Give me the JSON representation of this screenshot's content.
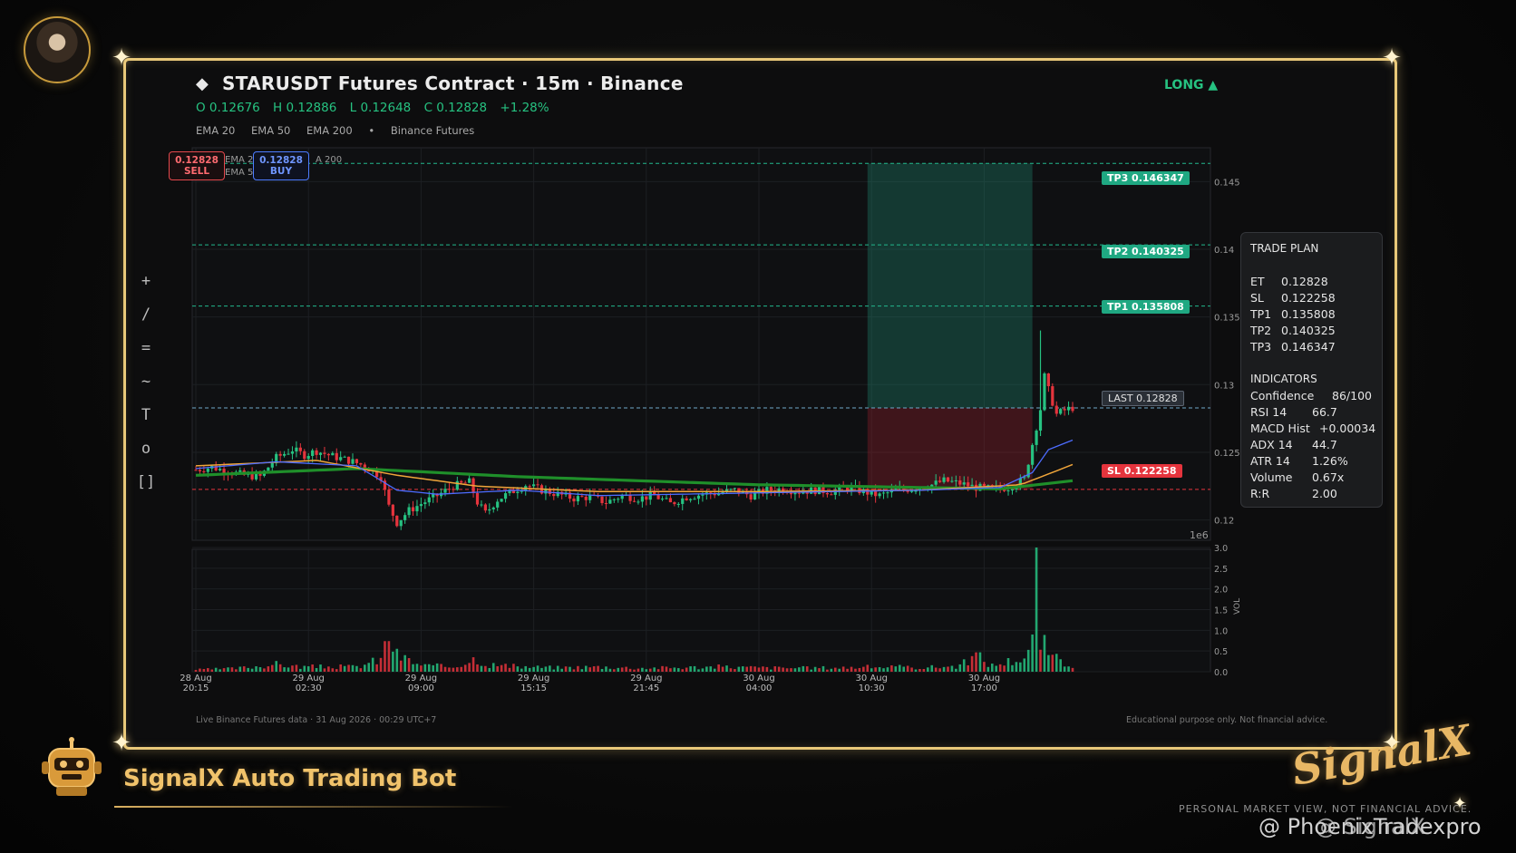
{
  "header": {
    "title": "STARUSDT Futures Contract  ·  15m  ·  Binance",
    "ohlc": {
      "open": "O 0.12676",
      "high": "H 0.12886",
      "low": "L 0.12648",
      "close": "C 0.12828",
      "change": "+1.28%"
    },
    "ema_labels": [
      "EMA 20",
      "EMA 50",
      "EMA 200",
      "•",
      "Binance Futures"
    ],
    "direction": "LONG ▲"
  },
  "chips": {
    "sell_price": "0.12828",
    "sell_label": "SELL",
    "buy_price": "0.12828",
    "buy_label": "BUY",
    "ghost_1": "EMA 2",
    "ghost_2": "EMA 5",
    "ghost_3": "A 200"
  },
  "toolbar": [
    "+",
    "/",
    "=",
    "~",
    "T",
    "o",
    "[]"
  ],
  "levels": {
    "tp3": "TP3  0.146347",
    "tp2": "TP2  0.140325",
    "tp1": "TP1  0.135808",
    "last": "LAST  0.12828",
    "sl": "SL  0.122258"
  },
  "trade_plan": {
    "heading": "TRADE PLAN",
    "rows": [
      [
        "ET",
        "0.12828"
      ],
      [
        "SL",
        "0.122258"
      ],
      [
        "TP1",
        "0.135808"
      ],
      [
        "TP2",
        "0.140325"
      ],
      [
        "TP3",
        "0.146347"
      ]
    ],
    "ind_heading": "INDICATORS",
    "indicators": [
      [
        "Confidence",
        "86/100"
      ],
      [
        "RSI 14",
        "66.7"
      ],
      [
        "MACD Hist",
        "+0.00034"
      ],
      [
        "ADX 14",
        "44.7"
      ],
      [
        "ATR 14",
        "1.26%"
      ],
      [
        "Volume",
        "0.67x"
      ],
      [
        "R:R",
        "2.00"
      ]
    ]
  },
  "footer": {
    "left": "Live Binance Futures data  ·  31 Aug 2026 · 00:29 UTC+7",
    "right": "Educational purpose only. Not financial advice."
  },
  "branding": {
    "bot_title": "SignalX Auto Trading Bot",
    "logo": "SignalX",
    "disclaimer": "PERSONAL MARKET VIEW, NOT FINANCIAL ADVICE.",
    "handle": "@ PhoenixTradexpro",
    "handle_overlay": "@ SignalX"
  },
  "colors": {
    "up": "#26c281",
    "down": "#e5343d",
    "ema20": "#4d6cff",
    "ema50": "#f0a53a",
    "ema200": "#1f8f2a",
    "gold": "#e9c879"
  },
  "chart_data": {
    "type": "candlestick",
    "price_axis": {
      "ticks": [
        "0.145",
        "0.14",
        "0.135",
        "0.13",
        "0.125",
        "0.12"
      ],
      "range": [
        0.1185,
        0.1475
      ],
      "scale_label": "1e6"
    },
    "volume_axis": {
      "ticks": [
        "3.0",
        "2.5",
        "2.0",
        "1.5",
        "1.0",
        "0.5",
        "0.0"
      ],
      "range": [
        0,
        3.0
      ],
      "label": "VOL"
    },
    "x_ticks": [
      [
        "28 Aug",
        "20:15"
      ],
      [
        "29 Aug",
        "02:30"
      ],
      [
        "29 Aug",
        "09:00"
      ],
      [
        "29 Aug",
        "15:15"
      ],
      [
        "29 Aug",
        "21:45"
      ],
      [
        "30 Aug",
        "04:00"
      ],
      [
        "30 Aug",
        "10:30"
      ],
      [
        "30 Aug",
        "17:00"
      ]
    ],
    "levels": {
      "tp3": 0.146347,
      "tp2": 0.140325,
      "tp1": 0.135808,
      "entry": 0.12828,
      "sl": 0.122258
    },
    "price_path": [
      [
        0,
        0.1237
      ],
      [
        4,
        0.1239
      ],
      [
        8,
        0.1236
      ],
      [
        12,
        0.1233
      ],
      [
        16,
        0.1232
      ],
      [
        20,
        0.1246
      ],
      [
        24,
        0.1252
      ],
      [
        27,
        0.1248
      ],
      [
        30,
        0.1251
      ],
      [
        34,
        0.1247
      ],
      [
        38,
        0.1244
      ],
      [
        42,
        0.124
      ],
      [
        46,
        0.1232
      ],
      [
        48,
        0.121
      ],
      [
        50,
        0.1198
      ],
      [
        53,
        0.1207
      ],
      [
        56,
        0.1212
      ],
      [
        60,
        0.1218
      ],
      [
        64,
        0.1225
      ],
      [
        68,
        0.1228
      ],
      [
        70,
        0.1213
      ],
      [
        72,
        0.1205
      ],
      [
        75,
        0.1215
      ],
      [
        78,
        0.122
      ],
      [
        82,
        0.1226
      ],
      [
        86,
        0.1222
      ],
      [
        90,
        0.1219
      ],
      [
        94,
        0.1216
      ],
      [
        98,
        0.1217
      ],
      [
        102,
        0.1213
      ],
      [
        106,
        0.1218
      ],
      [
        110,
        0.1216
      ],
      [
        114,
        0.1218
      ],
      [
        118,
        0.1212
      ],
      [
        122,
        0.1217
      ],
      [
        126,
        0.1219
      ],
      [
        130,
        0.122
      ],
      [
        134,
        0.1222
      ],
      [
        138,
        0.1218
      ],
      [
        142,
        0.1222
      ],
      [
        146,
        0.1223
      ],
      [
        150,
        0.1221
      ],
      [
        154,
        0.1222
      ],
      [
        158,
        0.1221
      ],
      [
        162,
        0.1224
      ],
      [
        166,
        0.1221
      ],
      [
        170,
        0.1218
      ],
      [
        174,
        0.1222
      ],
      [
        178,
        0.1223
      ],
      [
        182,
        0.1225
      ],
      [
        186,
        0.1229
      ],
      [
        190,
        0.1227
      ],
      [
        194,
        0.1224
      ],
      [
        198,
        0.1223
      ],
      [
        202,
        0.1224
      ],
      [
        206,
        0.123
      ],
      [
        210,
        0.1282
      ],
      [
        211,
        0.1306
      ],
      [
        212,
        0.1296
      ],
      [
        214,
        0.1278
      ],
      [
        216,
        0.1281
      ],
      [
        218,
        0.1283
      ]
    ],
    "volume_path": [
      [
        0,
        0.05
      ],
      [
        10,
        0.08
      ],
      [
        20,
        0.18
      ],
      [
        26,
        0.12
      ],
      [
        40,
        0.12
      ],
      [
        46,
        0.3
      ],
      [
        48,
        0.9
      ],
      [
        50,
        0.4
      ],
      [
        56,
        0.15
      ],
      [
        64,
        0.12
      ],
      [
        70,
        0.35
      ],
      [
        72,
        0.18
      ],
      [
        80,
        0.12
      ],
      [
        90,
        0.1
      ],
      [
        100,
        0.12
      ],
      [
        110,
        0.09
      ],
      [
        120,
        0.1
      ],
      [
        130,
        0.12
      ],
      [
        140,
        0.1
      ],
      [
        150,
        0.09
      ],
      [
        160,
        0.1
      ],
      [
        170,
        0.12
      ],
      [
        180,
        0.1
      ],
      [
        190,
        0.14
      ],
      [
        194,
        0.4
      ],
      [
        198,
        0.15
      ],
      [
        206,
        0.35
      ],
      [
        208,
        0.7
      ],
      [
        209,
        3.0
      ],
      [
        210,
        0.8
      ],
      [
        212,
        0.45
      ],
      [
        214,
        0.3
      ],
      [
        216,
        0.2
      ],
      [
        218,
        0.18
      ]
    ],
    "ema_paths": {
      "ema20": [
        [
          0,
          0.1238
        ],
        [
          20,
          0.1243
        ],
        [
          40,
          0.124
        ],
        [
          50,
          0.1222
        ],
        [
          60,
          0.1219
        ],
        [
          80,
          0.1222
        ],
        [
          100,
          0.1218
        ],
        [
          140,
          0.122
        ],
        [
          180,
          0.1222
        ],
        [
          200,
          0.1224
        ],
        [
          208,
          0.1235
        ],
        [
          212,
          0.1252
        ],
        [
          218,
          0.1259
        ]
      ],
      "ema50": [
        [
          0,
          0.124
        ],
        [
          30,
          0.1244
        ],
        [
          50,
          0.1233
        ],
        [
          70,
          0.1225
        ],
        [
          100,
          0.1221
        ],
        [
          140,
          0.1221
        ],
        [
          180,
          0.1222
        ],
        [
          205,
          0.1226
        ],
        [
          212,
          0.1234
        ],
        [
          218,
          0.1241
        ]
      ],
      "ema200": [
        [
          0,
          0.1233
        ],
        [
          40,
          0.1238
        ],
        [
          80,
          0.1232
        ],
        [
          140,
          0.1226
        ],
        [
          200,
          0.1223
        ],
        [
          218,
          0.1229
        ]
      ]
    }
  }
}
